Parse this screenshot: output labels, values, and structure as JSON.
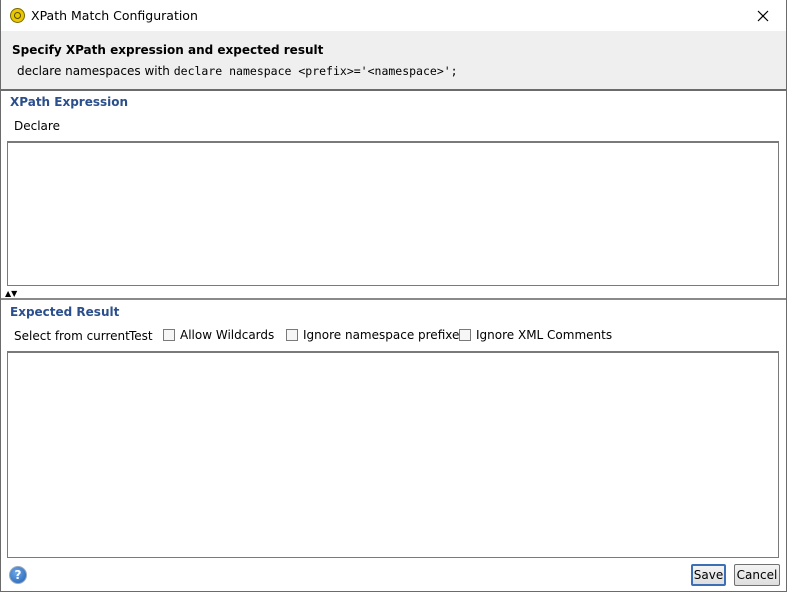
{
  "window": {
    "title": "XPath Match Configuration",
    "icon": "soapui-icon",
    "close_icon": "close-icon"
  },
  "header": {
    "title": "Specify XPath expression and expected result",
    "description_prefix": "declare namespaces with ",
    "description_code": "declare namespace <prefix>='<namespace>';"
  },
  "xpath_section": {
    "title": "XPath Expression",
    "declare_label": "Declare",
    "expression_value": ""
  },
  "splitter": {
    "arrows": "▲▼"
  },
  "expected_section": {
    "title": "Expected Result",
    "select_from_current_label": "Select from current",
    "test_label": "Test",
    "checkboxes": [
      {
        "label": "Allow Wildcards",
        "checked": false
      },
      {
        "label": "Ignore namespace prefixes",
        "checked": false
      },
      {
        "label": "Ignore XML Comments",
        "checked": false
      }
    ],
    "result_value": ""
  },
  "footer": {
    "help_label": "?",
    "save_label": "Save",
    "cancel_label": "Cancel"
  },
  "colors": {
    "section_title": "#2b4f8c",
    "header_bg": "#efefef",
    "default_button_border": "#3c6fb5"
  }
}
